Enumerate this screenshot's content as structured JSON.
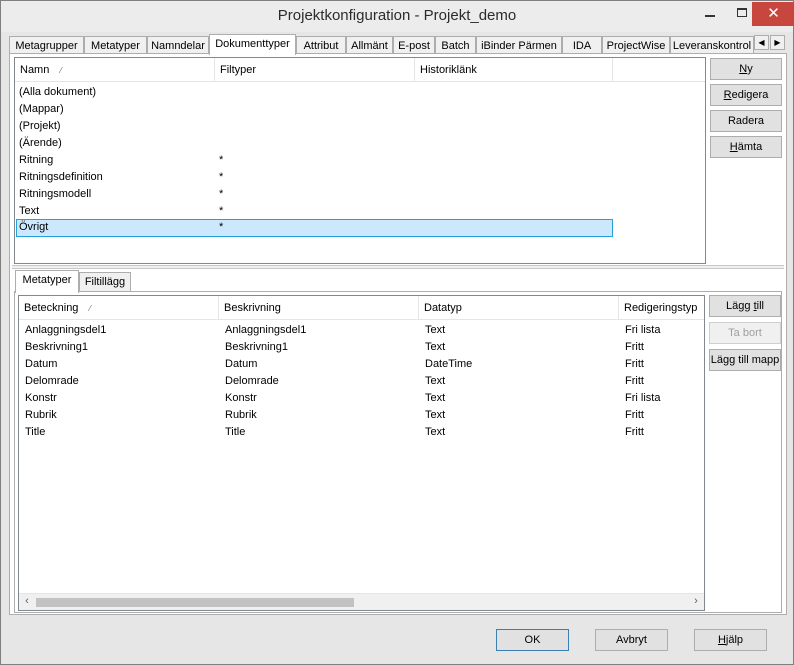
{
  "window": {
    "title": "Projektkonfiguration - Projekt_demo",
    "minimize_glyph": "",
    "maximize_glyph": "",
    "close_glyph": "✕"
  },
  "tabs": [
    {
      "label": "Metagrupper"
    },
    {
      "label": "Metatyper"
    },
    {
      "label": "Namndelar"
    },
    {
      "label": "Dokumenttyper",
      "active": true
    },
    {
      "label": "Attribut"
    },
    {
      "label": "Allmänt"
    },
    {
      "label": "E-post"
    },
    {
      "label": "Batch"
    },
    {
      "label": "iBinder Pärmen"
    },
    {
      "label": "IDA"
    },
    {
      "label": "ProjectWise"
    },
    {
      "label": "Leveranskontrol"
    }
  ],
  "tab_scroll": {
    "left": "◀",
    "right": "▶"
  },
  "doc_list": {
    "columns": [
      "Namn",
      "Filtyper",
      "Historiklänk"
    ],
    "sort_glyph": "⁄",
    "rows": [
      {
        "name": "(Alla dokument)",
        "filetypes": "",
        "history": ""
      },
      {
        "name": "(Mappar)",
        "filetypes": "",
        "history": ""
      },
      {
        "name": "(Projekt)",
        "filetypes": "",
        "history": ""
      },
      {
        "name": "(Ärende)",
        "filetypes": "",
        "history": ""
      },
      {
        "name": "Ritning",
        "filetypes": "*",
        "history": ""
      },
      {
        "name": "Ritningsdefinition",
        "filetypes": "*",
        "history": ""
      },
      {
        "name": "Ritningsmodell",
        "filetypes": "*",
        "history": ""
      },
      {
        "name": "Text",
        "filetypes": "*",
        "history": ""
      },
      {
        "name": "Övrigt",
        "filetypes": "*",
        "history": "",
        "selected": true
      }
    ]
  },
  "doc_buttons": {
    "ny": {
      "pre": "",
      "u": "N",
      "post": "y"
    },
    "redigera": {
      "pre": "",
      "u": "R",
      "post": "edigera"
    },
    "radera": {
      "pre": "Radera",
      "u": "",
      "post": ""
    },
    "hamta": {
      "pre": "",
      "u": "H",
      "post": "ämta"
    }
  },
  "subtabs": [
    {
      "label": "Metatyper",
      "active": true
    },
    {
      "label": "Filtillägg"
    }
  ],
  "meta_list": {
    "columns": [
      "Beteckning",
      "Beskrivning",
      "Datatyp",
      "Redigeringstyp"
    ],
    "sort_glyph": "⁄",
    "rows": [
      [
        "Anlaggningsdel1",
        "Anlaggningsdel1",
        "Text",
        "Fri lista"
      ],
      [
        "Beskrivning1",
        "Beskrivning1",
        "Text",
        "Fritt"
      ],
      [
        "Datum",
        "Datum",
        "DateTime",
        "Fritt"
      ],
      [
        "Delomrade",
        "Delomrade",
        "Text",
        "Fritt"
      ],
      [
        "Konstr",
        "Konstr",
        "Text",
        "Fri lista"
      ],
      [
        "Rubrik",
        "Rubrik",
        "Text",
        "Fritt"
      ],
      [
        "Title",
        "Title",
        "Text",
        "Fritt"
      ]
    ],
    "scroll_left": "‹",
    "scroll_right": "›"
  },
  "meta_buttons": {
    "lagg_till": {
      "pre": "Lägg ",
      "u": "t",
      "post": "ill"
    },
    "ta_bort": {
      "pre": "Ta bort",
      "u": "",
      "post": "",
      "disabled": true
    },
    "lagg_till_mapp": {
      "pre": "Lägg till mapp",
      "u": "",
      "post": ""
    }
  },
  "footer": {
    "ok": "OK",
    "avbryt": "Avbryt",
    "hjalp": {
      "pre": "",
      "u": "H",
      "post": "jälp"
    }
  }
}
